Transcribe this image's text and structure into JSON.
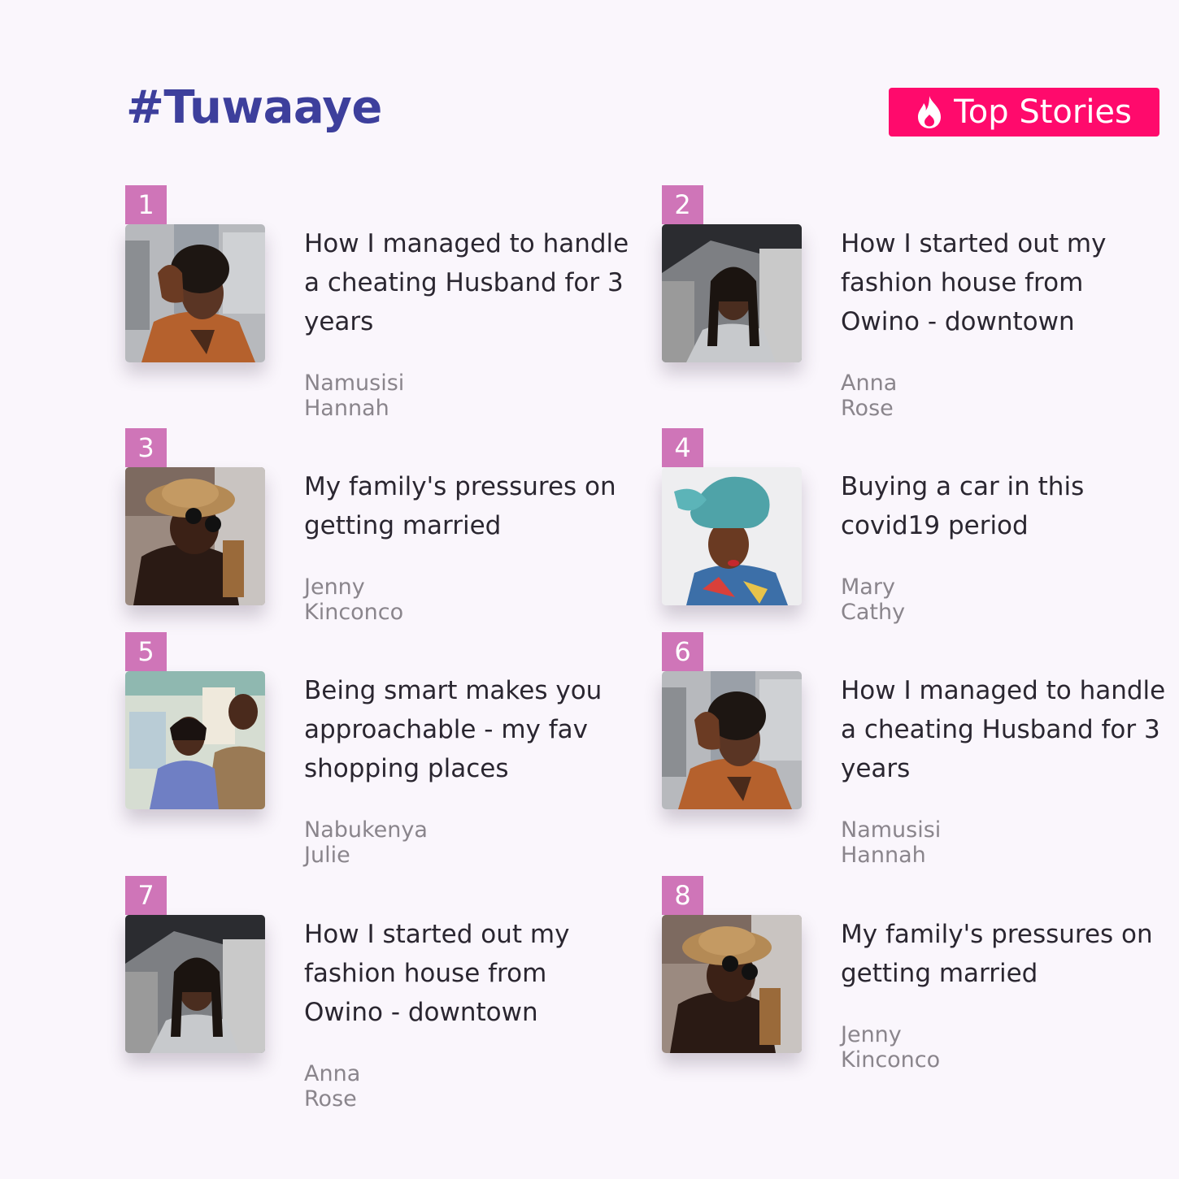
{
  "brand": {
    "title": "#Tuwaaye"
  },
  "header": {
    "top_stories_label": "Top Stories",
    "top_stories_icon": "flame-icon",
    "accent_color": "#ff0a6c",
    "brand_color": "#3d3f9c",
    "rank_badge_color": "#cf75b8"
  },
  "stories": [
    {
      "rank": "1",
      "title": "How I managed to handle a cheating Husband for 3 years",
      "author": "Namusisi Hannah"
    },
    {
      "rank": "2",
      "title": "How I started out my fashion house from Owino - downtown",
      "author": "Anna Rose"
    },
    {
      "rank": "3",
      "title": "My family's pressures on getting married",
      "author": "Jenny Kinconco"
    },
    {
      "rank": "4",
      "title": "Buying a car in this covid19 period",
      "author": "Mary Cathy"
    },
    {
      "rank": "5",
      "title": "Being smart makes you approachable - my fav shopping places",
      "author": "Nabukenya Julie"
    },
    {
      "rank": "6",
      "title": "How I managed to handle a cheating Husband for 3 years",
      "author": "Namusisi Hannah"
    },
    {
      "rank": "7",
      "title": "How I started out my fashion house from Owino - downtown",
      "author": "Anna Rose"
    },
    {
      "rank": "8",
      "title": "My family's pressures on getting married",
      "author": "Jenny Kinconco"
    }
  ]
}
